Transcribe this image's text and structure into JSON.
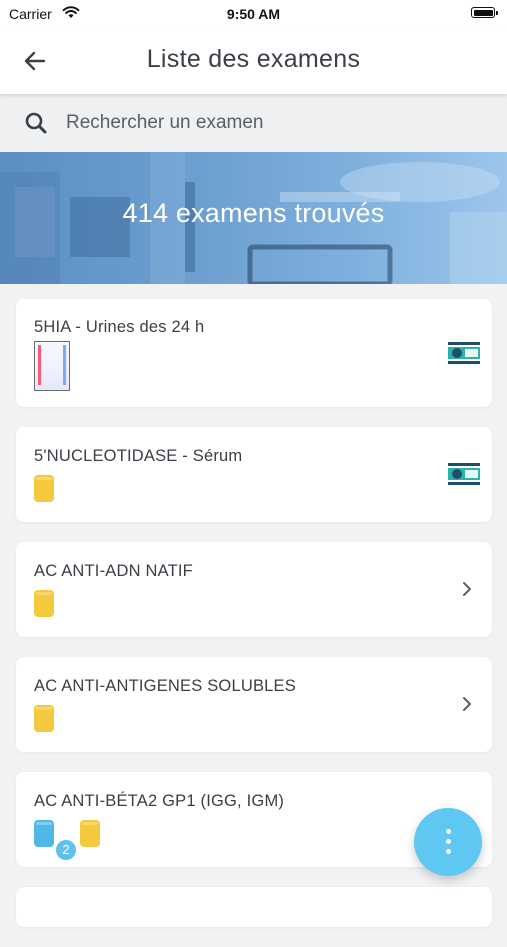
{
  "status_bar": {
    "carrier": "Carrier",
    "time": "9:50 AM"
  },
  "header": {
    "title": "Liste des examens",
    "back_icon": "arrow-left-icon"
  },
  "search": {
    "placeholder": "Rechercher un examen",
    "value": "",
    "icon": "search-icon"
  },
  "banner": {
    "text": "414 examens trouvés"
  },
  "exams": [
    {
      "title": "5HIA - Urines des 24 h",
      "tubes": [
        "urine-container"
      ],
      "action": "document-icon"
    },
    {
      "title": "5'NUCLEOTIDASE - Sérum",
      "tubes": [
        "yellow-tube"
      ],
      "action": "document-icon"
    },
    {
      "title": "AC ANTI-ADN NATIF",
      "tubes": [
        "yellow-tube"
      ],
      "action": "chevron-right-icon"
    },
    {
      "title": "AC ANTI-ANTIGENES SOLUBLES",
      "tubes": [
        "yellow-tube"
      ],
      "action": "chevron-right-icon"
    },
    {
      "title": "AC ANTI-BÉTA2 GP1 (IGG, IGM)",
      "tubes": [
        "blue-tube",
        "yellow-tube"
      ],
      "tube_badge": "2",
      "action": "none"
    }
  ],
  "fab": {
    "icon": "more-vertical-icon"
  },
  "colors": {
    "accent": "#5ec8f2",
    "card_icon": "#1d4e6f",
    "card_icon_accent": "#2bb3a8",
    "tube_yellow": "#f5c93d",
    "tube_blue": "#4fb8e4"
  }
}
